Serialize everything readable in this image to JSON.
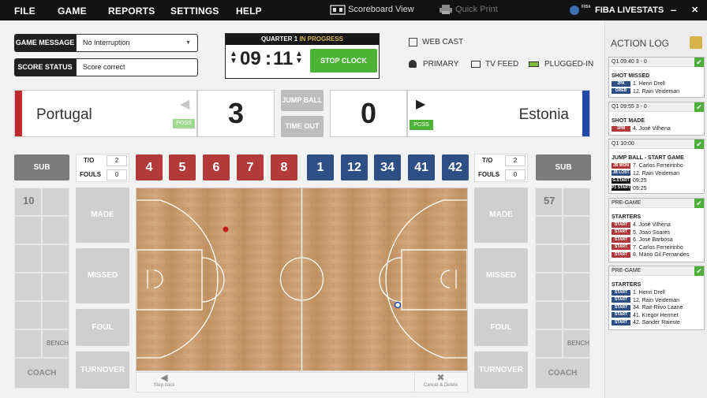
{
  "menu": {
    "file": "FILE",
    "game": "GAME",
    "reports": "REPORTS",
    "settings": "SETTINGS",
    "help": "HELP",
    "scoreboard": "Scoreboard View",
    "quickprint": "Quick Print",
    "brand": "FIBA LIVESTATS",
    "minimize": "–",
    "close": "✕"
  },
  "status": {
    "game_message_label": "GAME MESSAGE",
    "game_message_value": "No Interruption",
    "score_status_label": "SCORE STATUS",
    "score_status_value": "Score correct"
  },
  "clock": {
    "quarter": "QUARTER 1",
    "state": "IN PROGRESS",
    "minutes": "09",
    "seconds": "11",
    "stop": "STOP CLOCK"
  },
  "feeds": {
    "webcast": "WEB CAST",
    "primary": "PRIMARY",
    "tvfeed": "TV FEED",
    "plugged": "PLUGGED-IN"
  },
  "home": {
    "name": "Portugal",
    "score": "3",
    "poss": "POSS",
    "color": "#c0282d",
    "to": "2",
    "fouls": "0",
    "players": [
      "4",
      "5",
      "6",
      "7",
      "8"
    ]
  },
  "away": {
    "name": "Estonia",
    "score": "0",
    "poss": "POSS",
    "color": "#1e49a8",
    "to": "2",
    "fouls": "0",
    "players": [
      "1",
      "12",
      "34",
      "41",
      "42"
    ]
  },
  "center": {
    "jump": "JUMP BALL",
    "timeout": "TIME OUT"
  },
  "labels": {
    "sub": "SUB",
    "to": "T/O",
    "fouls": "FOULS",
    "made": "MADE",
    "missed": "MISSED",
    "foul": "FOUL",
    "turnover": "TURNOVER",
    "bench": "BENCH",
    "coach": "COACH",
    "step_back": "Step back",
    "cancel": "Cancel & Delete"
  },
  "home_bench_first": "10",
  "away_bench_first": "57",
  "log": {
    "title": "ACTION LOG",
    "c1": {
      "hd": "Q1   09:40    3 - 0",
      "title": "SHOT MISSED",
      "r1t": "2PA",
      "r1": "1. Henri Drell",
      "r2t": "OREB",
      "r2": "12. Rain Veideman"
    },
    "c2": {
      "hd": "Q1   09:55    3 - 0",
      "title": "SHOT MADE",
      "r1t": "3PM",
      "r1": "4. José Vilhena"
    },
    "c3": {
      "hd": "Q1   10:00",
      "title": "JUMP BALL - START GAME",
      "r1t": "JB WON",
      "r1": "7. Carlos Ferreirinho",
      "r2t": "JB LOST",
      "r2": "12. Rain Veideman",
      "r3t": "G.START",
      "r3": "09:25",
      "r4t": "P1 START",
      "r4": "09:25"
    },
    "c4": {
      "hd": "PRE-GAME",
      "title": "STARTERS",
      "tag": "START",
      "rows": [
        "4. José Vilhena",
        "5. Joao Soares",
        "6. Jose Barbosa",
        "7. Carlos Ferreirinho",
        "8. Mário Gil Fernandes"
      ]
    },
    "c5": {
      "hd": "PRE-GAME",
      "title": "STARTERS",
      "tag": "START",
      "rows": [
        "1. Henri Drell",
        "12. Rain Veideman",
        "34. Rait-Riivo Laane",
        "41. Kregor Hermet",
        "42. Sander Raieste"
      ]
    }
  }
}
